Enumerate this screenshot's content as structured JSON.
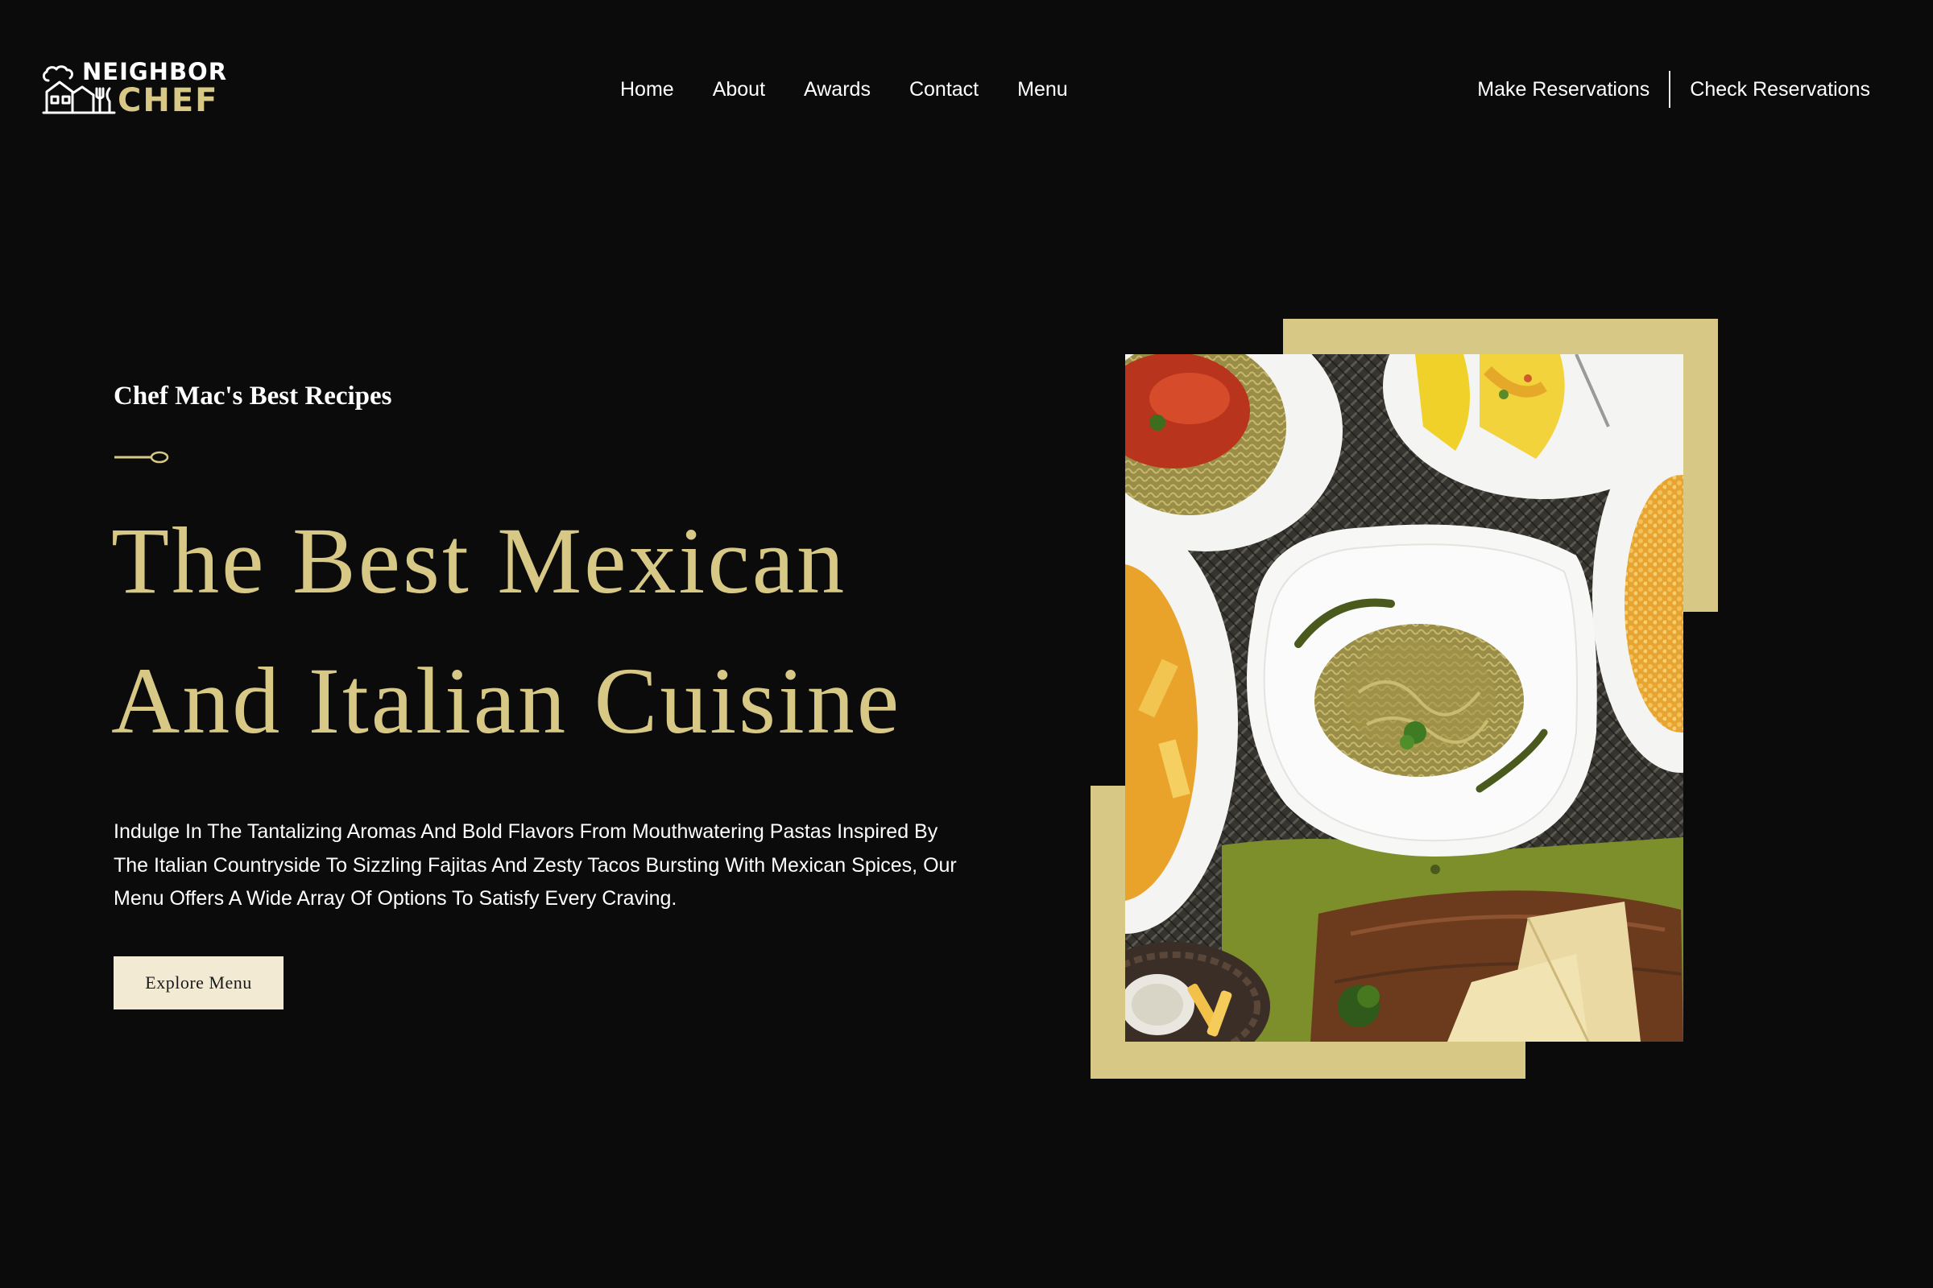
{
  "brand": {
    "line1": "NEIGHBOR",
    "line2": "CHEF"
  },
  "nav": {
    "items": [
      "Home",
      "About",
      "Awards",
      "Contact",
      "Menu"
    ]
  },
  "reservations": {
    "make": "Make Reservations",
    "check": "Check Reservations"
  },
  "hero": {
    "subtitle": "Chef Mac's Best Recipes",
    "headline": [
      "The Best Mexican",
      "And Italian Cuisine"
    ],
    "description": "Indulge In The Tantalizing Aromas And Bold Flavors From Mouthwatering Pastas Inspired By The Italian Countryside To Sizzling Fajitas And Zesty Tacos Bursting With Mexican Spices, Our Menu Offers A Wide Array Of Options To Satisfy Every Craving.",
    "cta": "Explore Menu"
  },
  "colors": {
    "background": "#0b0b0c",
    "accent_gold": "#d8c886",
    "button_bg": "#f3ead3"
  },
  "icons": {
    "logo": "chef-hat-house-logo-icon",
    "divider": "spoon-icon"
  }
}
